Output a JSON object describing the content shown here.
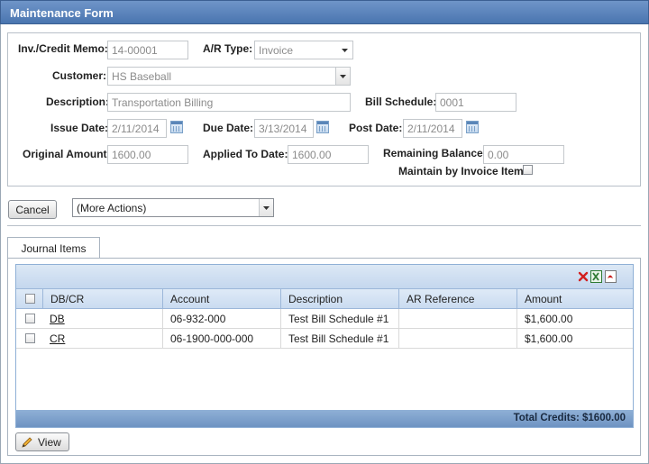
{
  "window": {
    "title": "Maintenance Form"
  },
  "form": {
    "inv_label": "Inv./Credit Memo:",
    "inv_value": "14-00001",
    "ar_type_label": "A/R Type:",
    "ar_type_value": "Invoice",
    "customer_label": "Customer:",
    "customer_value": "HS Baseball",
    "description_label": "Description:",
    "description_value": "Transportation Billing",
    "bill_schedule_label": "Bill Schedule:",
    "bill_schedule_value": "0001",
    "issue_date_label": "Issue Date:",
    "issue_date_value": "2/11/2014",
    "due_date_label": "Due Date:",
    "due_date_value": "3/13/2014",
    "post_date_label": "Post Date:",
    "post_date_value": "2/11/2014",
    "original_amount_label": "Original Amount:",
    "original_amount_value": "1600.00",
    "applied_label": "Applied To Date:",
    "applied_value": "1600.00",
    "remaining_label": "Remaining Balance:",
    "remaining_value": "0.00",
    "maintain_label": "Maintain by Invoice Item"
  },
  "actions": {
    "cancel_label": "Cancel",
    "more_actions_value": "(More Actions)"
  },
  "tabs": [
    {
      "label": "Journal Items"
    }
  ],
  "grid": {
    "columns": [
      "DB/CR",
      "Account",
      "Description",
      "AR Reference",
      "Amount"
    ],
    "rows": [
      {
        "dbcr": "DB",
        "account": "06-932-000",
        "description": "Test Bill Schedule #1",
        "ar_reference": "",
        "amount": "$1,600.00"
      },
      {
        "dbcr": "CR",
        "account": "06-1900-000-000",
        "description": "Test Bill Schedule #1",
        "ar_reference": "",
        "amount": "$1,600.00"
      }
    ],
    "total_label": "Total Credits: $1600.00",
    "toolbar_icons": [
      "delete-icon",
      "excel-export-icon",
      "pdf-export-icon"
    ]
  },
  "footer": {
    "view_label": "View"
  },
  "colors": {
    "title_bar": "#4a75b0",
    "grid_header": "#c9dbf0",
    "grid_footer": "#6e93c2"
  }
}
